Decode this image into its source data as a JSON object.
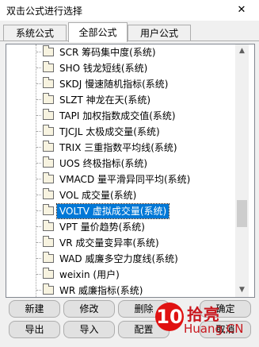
{
  "window": {
    "title": "双击公式进行选择",
    "close_glyph": "✕"
  },
  "tabs": [
    {
      "label": "系统公式"
    },
    {
      "label": "全部公式"
    },
    {
      "label": "用户公式"
    }
  ],
  "active_tab": "全部公式",
  "list": {
    "items": [
      {
        "label": "SCR 筹码集中度(系统)"
      },
      {
        "label": "SHO 钱龙短线(系统)"
      },
      {
        "label": "SKDJ 慢速随机指标(系统)"
      },
      {
        "label": "SLZT 神龙在天(系统)"
      },
      {
        "label": "TAPI 加权指数成交值(系统)"
      },
      {
        "label": "TJCJL 太极成交量(系统)"
      },
      {
        "label": "TRIX 三重指数平均线(系统)"
      },
      {
        "label": "UOS 终极指标(系统)"
      },
      {
        "label": "VMACD 量平滑异同平均(系统)"
      },
      {
        "label": "VOL 成交量(系统)"
      },
      {
        "label": "VOLTV 虚拟成交量(系统)"
      },
      {
        "label": "VPT 量价趋势(系统)"
      },
      {
        "label": "VR 成交量变异率(系统)"
      },
      {
        "label": "WAD 威廉多空力度线(系统)"
      },
      {
        "label": "weixin (用户)"
      },
      {
        "label": "WR 威廉指标(系统)"
      }
    ],
    "selected_label": "VOLTV 虚拟成交量(系统)",
    "folder_icon": "folder-icon"
  },
  "buttons": {
    "new": "新建",
    "modify": "修改",
    "delete": "删除",
    "export": "导出",
    "import": "导入",
    "config": "配置",
    "ok": "确定",
    "cancel": "取消"
  },
  "watermark": {
    "number": "10",
    "top": "拾亮",
    "bottom": "Huang.CN"
  },
  "colors": {
    "selection": "#0078d7",
    "watermark": "#c8161d"
  }
}
